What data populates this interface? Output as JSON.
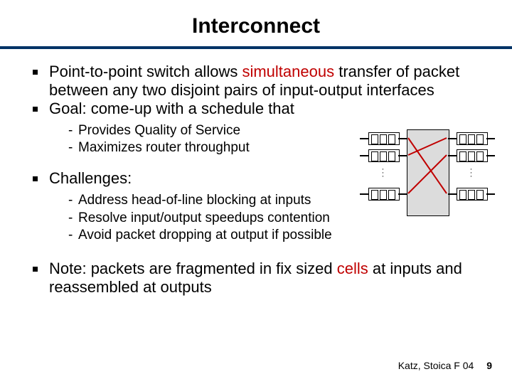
{
  "title": "Interconnect",
  "bullets": {
    "b1a": "Point-to-point switch allows ",
    "b1b": "simultaneous",
    "b1c": " transfer of packet between any two disjoint pairs of input-output interfaces",
    "b2": "Goal: come-up with a schedule that",
    "b2s1": "Provides Quality of Service",
    "b2s2": "Maximizes router throughput",
    "b3": "Challenges:",
    "b3s1": "Address head-of-line blocking at inputs",
    "b3s2": "Resolve input/output speedups contention",
    "b3s3": "Avoid packet dropping at output if possible",
    "b4a": "Note: packets are fragmented in fix sized ",
    "b4b": "cells",
    "b4c": " at inputs and reassembled  at outputs"
  },
  "footer": {
    "attribution": "Katz, Stoica F 04",
    "page": "9"
  }
}
